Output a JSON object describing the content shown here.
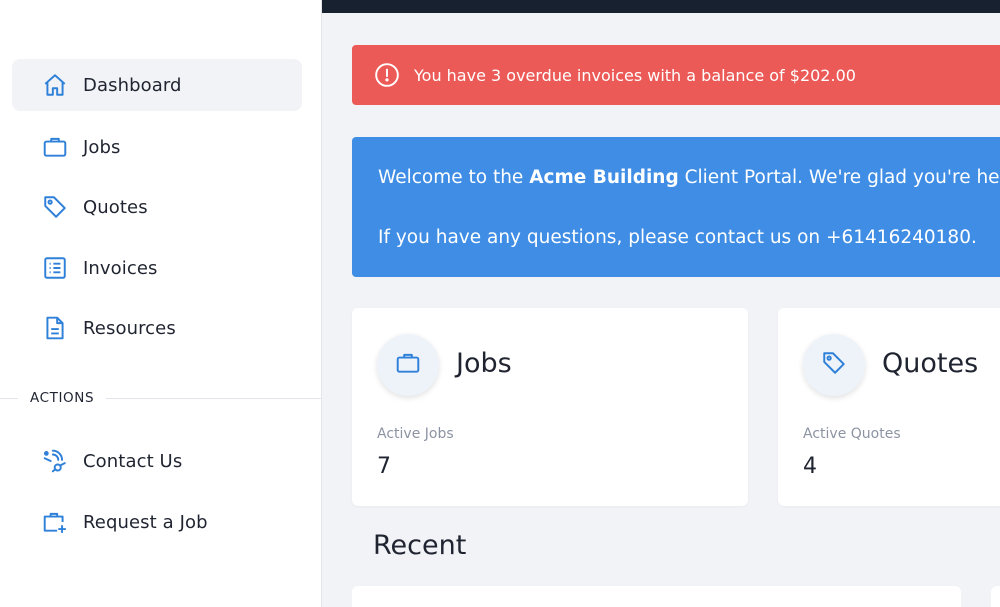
{
  "sidebar": {
    "nav": [
      {
        "label": "Dashboard",
        "icon": "home-icon",
        "active": true
      },
      {
        "label": "Jobs",
        "icon": "briefcase-icon"
      },
      {
        "label": "Quotes",
        "icon": "tag-icon"
      },
      {
        "label": "Invoices",
        "icon": "list-icon"
      },
      {
        "label": "Resources",
        "icon": "document-icon"
      }
    ],
    "actions_header": "ACTIONS",
    "actions": [
      {
        "label": "Contact Us",
        "icon": "contact-icon"
      },
      {
        "label": "Request a Job",
        "icon": "briefcase-plus-icon"
      }
    ]
  },
  "alert": {
    "message": "You have 3 overdue invoices with a balance of $202.00",
    "color": "#ec5a57"
  },
  "welcome": {
    "line1_prefix": "Welcome to the ",
    "company": "Acme Building",
    "line1_suffix": " Client Portal. We're glad you're here!",
    "line2": "If you have any questions, please contact us on +61416240180.",
    "color": "#3f8de4"
  },
  "cards": {
    "jobs": {
      "title": "Jobs",
      "stat_label": "Active Jobs",
      "stat_value": "7"
    },
    "quotes": {
      "title": "Quotes",
      "stat_label": "Active Quotes",
      "stat_value": "4"
    }
  },
  "recent": {
    "title": "Recent"
  },
  "colors": {
    "accent": "#2f80d8",
    "topbar": "#17212f"
  }
}
